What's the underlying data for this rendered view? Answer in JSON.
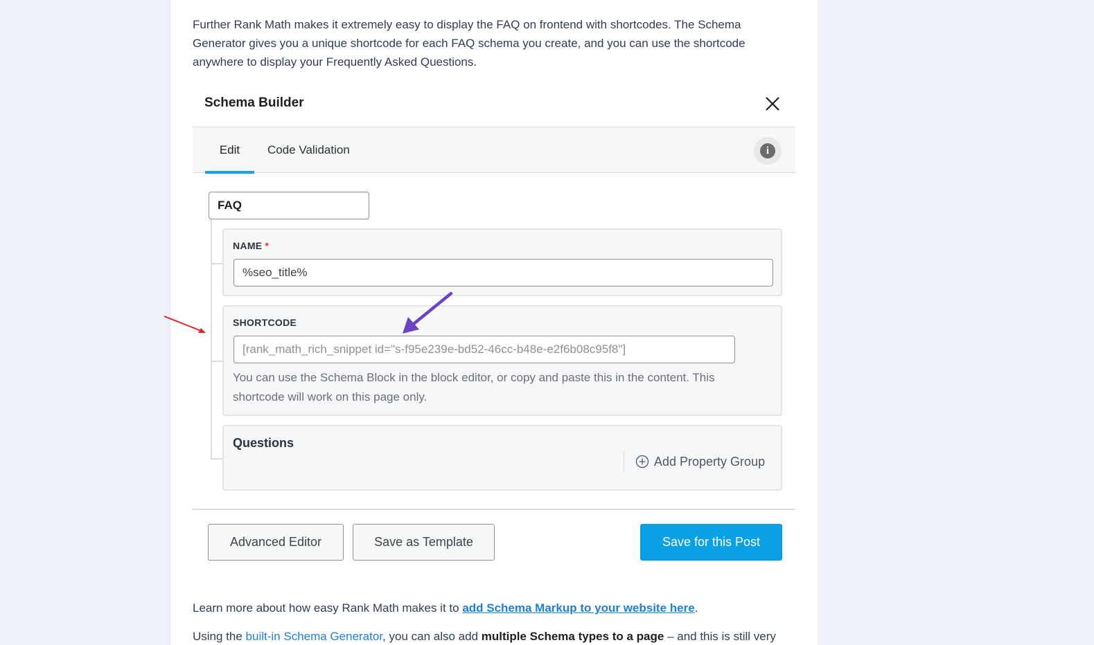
{
  "intro": {
    "text": "Further Rank Math makes it extremely easy to display the FAQ on frontend with shortcodes. The Schema Generator gives you a unique shortcode for each FAQ schema you create, and you can use the shortcode anywhere to display your Frequently Asked Questions."
  },
  "modal": {
    "title": "Schema Builder",
    "close_icon": "close-icon",
    "tabs": [
      {
        "label": "Edit",
        "active": true
      },
      {
        "label": "Code Validation",
        "active": false
      }
    ],
    "info_icon": "info-icon",
    "schema_type_value": "FAQ",
    "name_field": {
      "label": "NAME",
      "required_mark": "*",
      "value": "%seo_title%"
    },
    "shortcode_field": {
      "label": "SHORTCODE",
      "value": "[rank_math_rich_snippet id=\"s-f95e239e-bd52-46cc-b48e-e2f6b08c95f8\"]",
      "help": "You can use the Schema Block in the block editor, or copy and paste this in the content. This shortcode will work on this page only."
    },
    "questions": {
      "title": "Questions",
      "add_label": "Add Property Group"
    },
    "buttons": {
      "advanced_editor": "Advanced Editor",
      "save_template": "Save as Template",
      "save_post": "Save for this Post"
    }
  },
  "outro": {
    "lead": "Learn more about how easy Rank Math makes it to ",
    "link": "add Schema Markup to your website here",
    "end": "."
  },
  "outro2": {
    "t1": "Using the ",
    "link": "built-in Schema Generator",
    "t2": ", you can also add ",
    "bold": "multiple Schema types to a page",
    "t3": " – and this is still very"
  },
  "colors": {
    "accent": "#0aa0e4",
    "annotation_red": "#e8242a",
    "annotation_purple": "#6a44c2"
  }
}
